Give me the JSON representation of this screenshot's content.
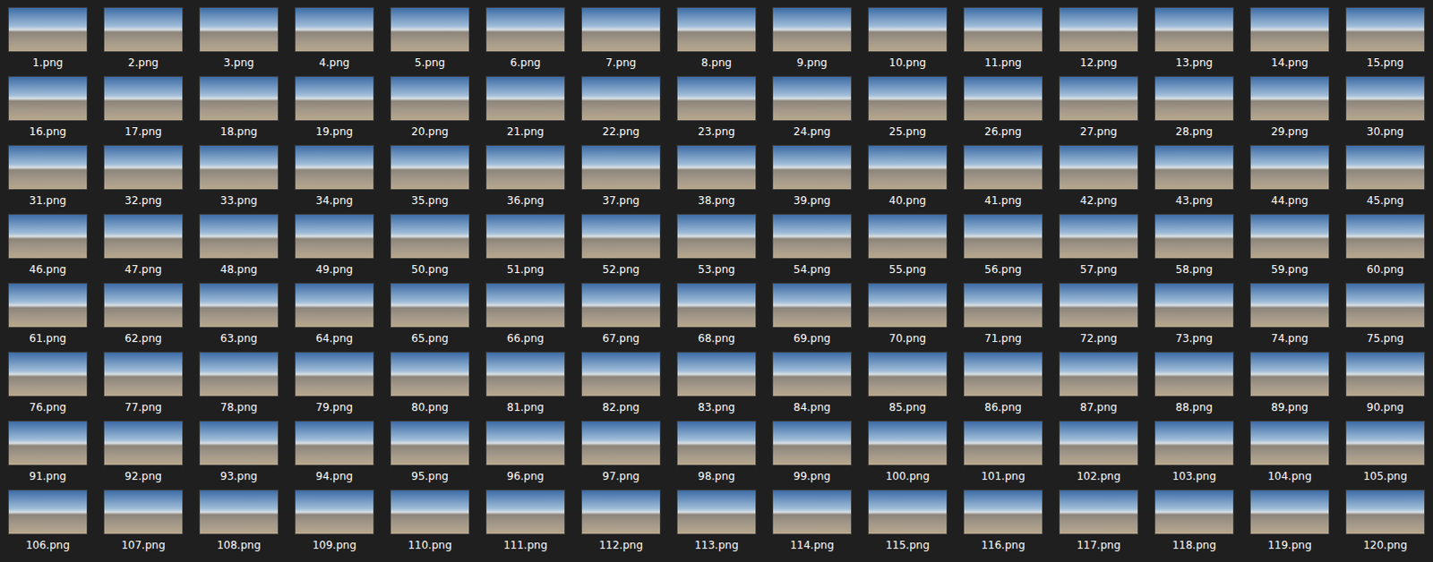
{
  "files": [
    {
      "name": "1.png"
    },
    {
      "name": "2.png"
    },
    {
      "name": "3.png"
    },
    {
      "name": "4.png"
    },
    {
      "name": "5.png"
    },
    {
      "name": "6.png"
    },
    {
      "name": "7.png"
    },
    {
      "name": "8.png"
    },
    {
      "name": "9.png"
    },
    {
      "name": "10.png"
    },
    {
      "name": "11.png"
    },
    {
      "name": "12.png"
    },
    {
      "name": "13.png"
    },
    {
      "name": "14.png"
    },
    {
      "name": "15.png"
    },
    {
      "name": "16.png"
    },
    {
      "name": "17.png"
    },
    {
      "name": "18.png"
    },
    {
      "name": "19.png"
    },
    {
      "name": "20.png"
    },
    {
      "name": "21.png"
    },
    {
      "name": "22.png"
    },
    {
      "name": "23.png"
    },
    {
      "name": "24.png"
    },
    {
      "name": "25.png"
    },
    {
      "name": "26.png"
    },
    {
      "name": "27.png"
    },
    {
      "name": "28.png"
    },
    {
      "name": "29.png"
    },
    {
      "name": "30.png"
    },
    {
      "name": "31.png"
    },
    {
      "name": "32.png"
    },
    {
      "name": "33.png"
    },
    {
      "name": "34.png"
    },
    {
      "name": "35.png"
    },
    {
      "name": "36.png"
    },
    {
      "name": "37.png"
    },
    {
      "name": "38.png"
    },
    {
      "name": "39.png"
    },
    {
      "name": "40.png"
    },
    {
      "name": "41.png"
    },
    {
      "name": "42.png"
    },
    {
      "name": "43.png"
    },
    {
      "name": "44.png"
    },
    {
      "name": "45.png"
    },
    {
      "name": "46.png"
    },
    {
      "name": "47.png"
    },
    {
      "name": "48.png"
    },
    {
      "name": "49.png"
    },
    {
      "name": "50.png"
    },
    {
      "name": "51.png"
    },
    {
      "name": "52.png"
    },
    {
      "name": "53.png"
    },
    {
      "name": "54.png"
    },
    {
      "name": "55.png"
    },
    {
      "name": "56.png"
    },
    {
      "name": "57.png"
    },
    {
      "name": "58.png"
    },
    {
      "name": "59.png"
    },
    {
      "name": "60.png"
    },
    {
      "name": "61.png"
    },
    {
      "name": "62.png"
    },
    {
      "name": "63.png"
    },
    {
      "name": "64.png"
    },
    {
      "name": "65.png"
    },
    {
      "name": "66.png"
    },
    {
      "name": "67.png"
    },
    {
      "name": "68.png"
    },
    {
      "name": "69.png"
    },
    {
      "name": "70.png"
    },
    {
      "name": "71.png"
    },
    {
      "name": "72.png"
    },
    {
      "name": "73.png"
    },
    {
      "name": "74.png"
    },
    {
      "name": "75.png"
    },
    {
      "name": "76.png"
    },
    {
      "name": "77.png"
    },
    {
      "name": "78.png"
    },
    {
      "name": "79.png"
    },
    {
      "name": "80.png"
    },
    {
      "name": "81.png"
    },
    {
      "name": "82.png"
    },
    {
      "name": "83.png"
    },
    {
      "name": "84.png"
    },
    {
      "name": "85.png"
    },
    {
      "name": "86.png"
    },
    {
      "name": "87.png"
    },
    {
      "name": "88.png"
    },
    {
      "name": "89.png"
    },
    {
      "name": "90.png"
    },
    {
      "name": "91.png"
    },
    {
      "name": "92.png"
    },
    {
      "name": "93.png"
    },
    {
      "name": "94.png"
    },
    {
      "name": "95.png"
    },
    {
      "name": "96.png"
    },
    {
      "name": "97.png"
    },
    {
      "name": "98.png"
    },
    {
      "name": "99.png"
    },
    {
      "name": "100.png"
    },
    {
      "name": "101.png"
    },
    {
      "name": "102.png"
    },
    {
      "name": "103.png"
    },
    {
      "name": "104.png"
    },
    {
      "name": "105.png"
    },
    {
      "name": "106.png"
    },
    {
      "name": "107.png"
    },
    {
      "name": "108.png"
    },
    {
      "name": "109.png"
    },
    {
      "name": "110.png"
    },
    {
      "name": "111.png"
    },
    {
      "name": "112.png"
    },
    {
      "name": "113.png"
    },
    {
      "name": "114.png"
    },
    {
      "name": "115.png"
    },
    {
      "name": "116.png"
    },
    {
      "name": "117.png"
    },
    {
      "name": "118.png"
    },
    {
      "name": "119.png"
    },
    {
      "name": "120.png"
    }
  ]
}
